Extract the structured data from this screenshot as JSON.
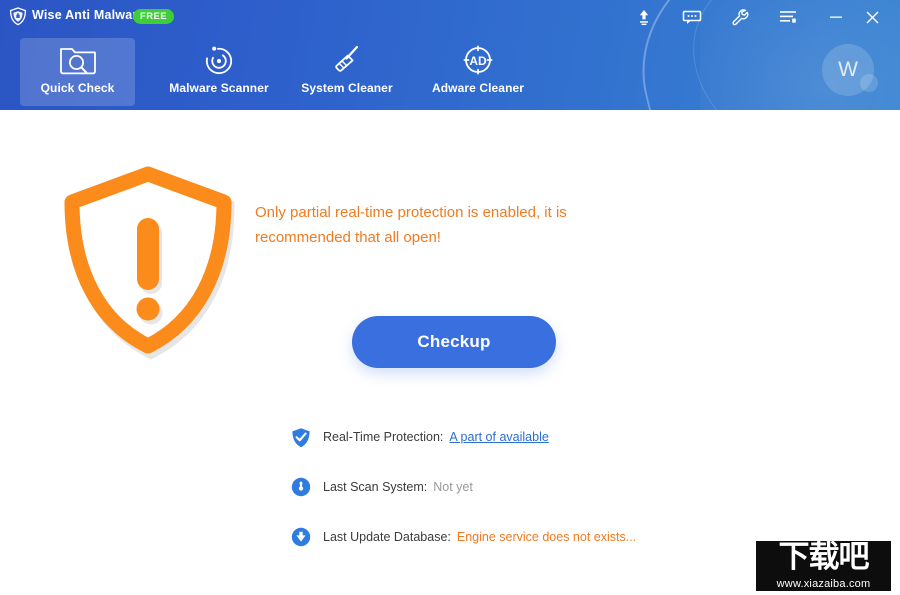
{
  "window": {
    "app_title": "Wise Anti Malware",
    "edition_badge": "FREE",
    "logo_icon": "shield-logo-icon"
  },
  "titlebar": {
    "buttons": [
      {
        "name": "upgrade-button",
        "icon": "upgrade-arrow-icon",
        "tooltip": "Upgrade"
      },
      {
        "name": "feedback-button",
        "icon": "chat-bubble-icon",
        "tooltip": "Feedback"
      },
      {
        "name": "settings-button",
        "icon": "wrench-icon",
        "tooltip": "Settings"
      },
      {
        "name": "menu-button",
        "icon": "menu-list-icon",
        "tooltip": "Menu"
      },
      {
        "name": "minimize-button",
        "icon": "minimize-icon",
        "tooltip": "Minimize"
      },
      {
        "name": "close-button",
        "icon": "close-x-icon",
        "tooltip": "Close"
      }
    ]
  },
  "nav": {
    "tabs": [
      {
        "label": "Quick Check",
        "icon": "folder-search-icon",
        "active": true
      },
      {
        "label": "Malware Scanner",
        "icon": "radar-scan-icon",
        "active": false
      },
      {
        "label": "System Cleaner",
        "icon": "broom-icon",
        "active": false
      },
      {
        "label": "Adware Cleaner",
        "icon": "ad-target-icon",
        "active": false
      }
    ]
  },
  "account": {
    "avatar_letter": "W",
    "avatar_icon": "user-avatar-icon"
  },
  "main": {
    "status_icon": "warning-shield-icon",
    "warning_text": "Only partial real-time protection is enabled, it is recommended that all open!",
    "action_button": "Checkup",
    "status_rows": [
      {
        "icon": "shield-check-icon",
        "label": "Real-Time Protection:",
        "value": "A part of available",
        "value_style": "link"
      },
      {
        "icon": "clock-gauge-icon",
        "label": "Last Scan System:",
        "value": "Not yet",
        "value_style": "muted"
      },
      {
        "icon": "download-arrow-icon",
        "label": "Last Update Database:",
        "value": "Engine service does not exists...",
        "value_style": "warn"
      }
    ]
  },
  "watermark": {
    "text": "下载吧",
    "url": "www.xiazaiba.com"
  },
  "colors": {
    "header_blue": "#2e60cc",
    "accent_blue": "#3a6fe0",
    "warning_orange": "#f07b22",
    "link_blue": "#2a6fd4",
    "badge_green": "#3fce3a",
    "muted_gray": "#9a9a9a"
  }
}
